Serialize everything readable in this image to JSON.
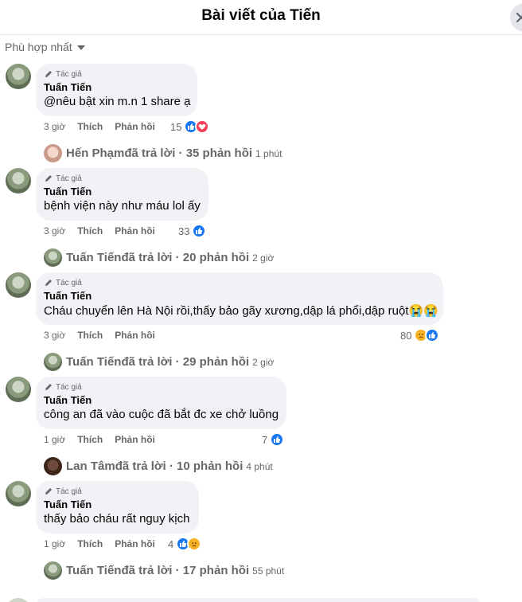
{
  "header": {
    "title": "Bài viết của Tiến"
  },
  "sort": {
    "label": "Phù hợp nhất"
  },
  "comments": [
    {
      "badge": "Tác giả",
      "author": "Tuấn Tiến",
      "text": "@nêu bật xin m.n 1 share ạ",
      "time": "3 giờ",
      "like": "Thích",
      "reply": "Phản hồi",
      "reaction_count": "15",
      "reactions": [
        "like-icon",
        "heart-icon"
      ],
      "replies": {
        "name": "Hến Phạm",
        "text": " đã trả lời · 35 phản hồi",
        "time": "1 phút"
      }
    },
    {
      "badge": "Tác giả",
      "author": "Tuấn Tiến",
      "text": "bệnh viện này như máu lol ấy",
      "time": "3 giờ",
      "like": "Thích",
      "reply": "Phản hồi",
      "reaction_count": "33",
      "reactions": [
        "like-icon"
      ],
      "replies": {
        "name": "Tuấn Tiến",
        "text": " đã trả lời · 20 phản hồi",
        "time": "2 giờ"
      }
    },
    {
      "badge": "Tác giả",
      "author": "Tuấn Tiến",
      "text": "Cháu chuyển lên Hà Nội rồi,thấy bảo gãy xương,dập lá phổi,dập ruột😭😭",
      "time": "3 giờ",
      "like": "Thích",
      "reply": "Phản hồi",
      "reaction_count": "80",
      "reactions": [
        "sad-icon",
        "like-icon"
      ],
      "replies": {
        "name": "Tuấn Tiến",
        "text": " đã trả lời · 29 phản hồi",
        "time": "2 giờ"
      }
    },
    {
      "badge": "Tác giả",
      "author": "Tuấn Tiến",
      "text": "công an đã vào cuộc đã bắt đc xe chở luồng",
      "time": "1 giờ",
      "like": "Thích",
      "reply": "Phản hồi",
      "reaction_count": "7",
      "reactions": [
        "like-icon"
      ],
      "replies": {
        "name": "Lan Tâm",
        "text": " đã trả lời · 10 phản hồi",
        "time": "4 phút"
      }
    },
    {
      "badge": "Tác giả",
      "author": "Tuấn Tiến",
      "text": "thấy bảo cháu rất nguy kịch",
      "time": "1 giờ",
      "like": "Thích",
      "reply": "Phản hồi",
      "reaction_count": "4",
      "reactions": [
        "like-icon",
        "sad-icon"
      ],
      "replies": {
        "name": "Tuấn Tiến",
        "text": " đã trả lời · 17 phản hồi",
        "time": "55 phút"
      }
    }
  ],
  "colors": {
    "like": "#1877f2",
    "heart": "#f33e58",
    "sad": "#f7b125",
    "bubble": "#f0f2f5",
    "muted": "#65676b"
  }
}
